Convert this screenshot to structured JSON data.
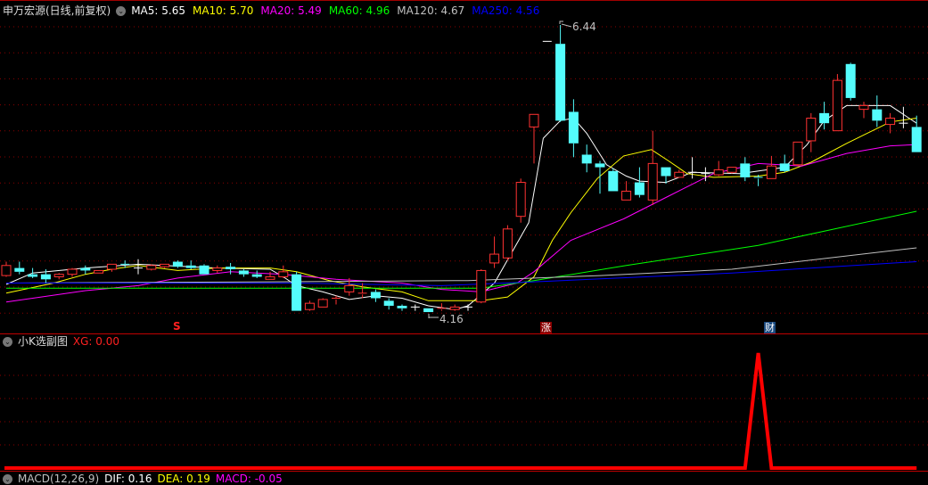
{
  "header": {
    "title": "申万宏源(日线,前复权)",
    "ma": [
      {
        "label": "MA5: 5.65",
        "color": "#ffffff"
      },
      {
        "label": "MA10: 5.70",
        "color": "#ffff00"
      },
      {
        "label": "MA20: 5.49",
        "color": "#ff00ff"
      },
      {
        "label": "MA60: 4.96",
        "color": "#00ff00"
      },
      {
        "label": "MA120: 4.67",
        "color": "#c0c0c0"
      },
      {
        "label": "MA250: 4.56",
        "color": "#0000ff"
      }
    ]
  },
  "sub": {
    "title": "小K选副图",
    "xg_label": "XG: 0.00"
  },
  "macd": {
    "title": "MACD(12,26,9)",
    "dif": "DIF: 0.16",
    "dea": "DEA: 0.19",
    "macd": "MACD: -0.05"
  },
  "markers": {
    "s": "S",
    "zhang": "涨",
    "cai": "财"
  },
  "colors": {
    "up": "#ff3232",
    "down": "#54fcfc",
    "flat": "#ffffff",
    "grid": "#8b0000",
    "xg": "#ff0000"
  },
  "chart_data": [
    {
      "type": "candlestick",
      "price_range": [
        4.16,
        6.44
      ],
      "high_label": "6.44",
      "low_label": "4.16",
      "ohlc": [
        [
          4.45,
          4.56,
          4.44,
          4.53
        ],
        [
          4.51,
          4.56,
          4.46,
          4.48
        ],
        [
          4.46,
          4.51,
          4.43,
          4.44
        ],
        [
          4.46,
          4.5,
          4.39,
          4.42
        ],
        [
          4.44,
          4.47,
          4.42,
          4.46
        ],
        [
          4.46,
          4.51,
          4.44,
          4.5
        ],
        [
          4.51,
          4.53,
          4.46,
          4.49
        ],
        [
          4.47,
          4.49,
          4.47,
          4.49
        ],
        [
          4.5,
          4.54,
          4.48,
          4.54
        ],
        [
          4.54,
          4.57,
          4.51,
          4.53
        ],
        [
          4.51,
          4.58,
          4.46,
          4.51
        ],
        [
          4.5,
          4.54,
          4.49,
          4.53
        ],
        [
          4.52,
          4.54,
          4.51,
          4.54
        ],
        [
          4.56,
          4.57,
          4.51,
          4.52
        ],
        [
          4.53,
          4.57,
          4.5,
          4.51
        ],
        [
          4.53,
          4.54,
          4.46,
          4.46
        ],
        [
          4.49,
          4.53,
          4.47,
          4.51
        ],
        [
          4.52,
          4.55,
          4.46,
          4.5
        ],
        [
          4.49,
          4.5,
          4.44,
          4.46
        ],
        [
          4.46,
          4.49,
          4.43,
          4.44
        ],
        [
          4.42,
          4.48,
          4.42,
          4.44
        ],
        [
          4.44,
          4.53,
          4.43,
          4.48
        ],
        [
          4.46,
          4.48,
          4.17,
          4.17
        ],
        [
          4.18,
          4.25,
          4.17,
          4.23
        ],
        [
          4.2,
          4.27,
          4.2,
          4.26
        ],
        [
          4.26,
          4.29,
          4.22,
          4.27
        ],
        [
          4.32,
          4.43,
          4.29,
          4.37
        ],
        [
          4.3,
          4.39,
          4.27,
          4.31
        ],
        [
          4.32,
          4.34,
          4.24,
          4.27
        ],
        [
          4.25,
          4.27,
          4.18,
          4.21
        ],
        [
          4.21,
          4.22,
          4.17,
          4.19
        ],
        [
          4.2,
          4.22,
          4.17,
          4.2
        ],
        [
          4.19,
          4.19,
          4.16,
          4.16
        ],
        [
          4.18,
          4.23,
          4.17,
          4.19
        ],
        [
          4.18,
          4.22,
          4.17,
          4.2
        ],
        [
          4.2,
          4.22,
          4.17,
          4.2
        ],
        [
          4.24,
          4.5,
          4.23,
          4.49
        ],
        [
          4.55,
          4.76,
          4.51,
          4.62
        ],
        [
          4.59,
          4.85,
          4.57,
          4.82
        ],
        [
          4.92,
          5.22,
          4.87,
          5.19
        ],
        [
          5.63,
          5.73,
          5.34,
          5.73
        ],
        [
          6.31,
          6.31,
          6.31,
          6.31
        ],
        [
          6.29,
          6.44,
          5.67,
          5.68
        ],
        [
          5.75,
          5.85,
          5.39,
          5.5
        ],
        [
          5.41,
          5.49,
          5.27,
          5.34
        ],
        [
          5.34,
          5.36,
          5.1,
          5.31
        ],
        [
          5.28,
          5.3,
          5.12,
          5.12
        ],
        [
          5.05,
          5.2,
          5.05,
          5.12
        ],
        [
          5.19,
          5.31,
          5.07,
          5.09
        ],
        [
          5.05,
          5.6,
          5.01,
          5.34
        ],
        [
          5.31,
          5.31,
          5.18,
          5.24
        ],
        [
          5.23,
          5.29,
          5.23,
          5.27
        ],
        [
          5.27,
          5.39,
          5.22,
          5.27
        ],
        [
          5.26,
          5.31,
          5.2,
          5.26
        ],
        [
          5.25,
          5.36,
          5.24,
          5.29
        ],
        [
          5.27,
          5.31,
          5.26,
          5.31
        ],
        [
          5.34,
          5.39,
          5.2,
          5.23
        ],
        [
          5.23,
          5.25,
          5.16,
          5.22
        ],
        [
          5.22,
          5.4,
          5.22,
          5.32
        ],
        [
          5.34,
          5.41,
          5.27,
          5.28
        ],
        [
          5.33,
          5.51,
          5.32,
          5.51
        ],
        [
          5.52,
          5.74,
          5.43,
          5.7
        ],
        [
          5.74,
          5.83,
          5.61,
          5.66
        ],
        [
          5.6,
          6.05,
          5.6,
          6.0
        ],
        [
          6.13,
          6.14,
          5.84,
          5.86
        ],
        [
          5.77,
          5.83,
          5.7,
          5.8
        ],
        [
          5.77,
          5.88,
          5.63,
          5.68
        ],
        [
          5.65,
          5.74,
          5.58,
          5.7
        ],
        [
          5.66,
          5.79,
          5.62,
          5.66
        ],
        [
          5.63,
          5.72,
          5.43,
          5.43
        ]
      ],
      "ma_lines": [
        {
          "name": "MA5",
          "color": "#ffffff",
          "points": [
            [
              0,
              4.38
            ],
            [
              2,
              4.47
            ],
            [
              6,
              4.51
            ],
            [
              10,
              4.54
            ],
            [
              16,
              4.51
            ],
            [
              20,
              4.5
            ],
            [
              21,
              4.44
            ],
            [
              22,
              4.37
            ],
            [
              24,
              4.32
            ],
            [
              26,
              4.26
            ],
            [
              28,
              4.29
            ],
            [
              30,
              4.27
            ],
            [
              32,
              4.21
            ],
            [
              34,
              4.18
            ],
            [
              35,
              4.21
            ],
            [
              37,
              4.39
            ],
            [
              39.6,
              4.87
            ],
            [
              40.7,
              5.54
            ],
            [
              42,
              5.68
            ],
            [
              43,
              5.7
            ],
            [
              44,
              5.58
            ],
            [
              45.5,
              5.33
            ],
            [
              47,
              5.24
            ],
            [
              48,
              5.2
            ],
            [
              50,
              5.19
            ],
            [
              52,
              5.27
            ],
            [
              55.6,
              5.26
            ],
            [
              59,
              5.31
            ],
            [
              60.7,
              5.49
            ],
            [
              62,
              5.68
            ],
            [
              63.7,
              5.8
            ],
            [
              67,
              5.8
            ],
            [
              69,
              5.66
            ]
          ]
        },
        {
          "name": "MA10",
          "color": "#ffff00",
          "points": [
            [
              0,
              4.31
            ],
            [
              3.6,
              4.39
            ],
            [
              6,
              4.46
            ],
            [
              8,
              4.5
            ],
            [
              10,
              4.53
            ],
            [
              13,
              4.49
            ],
            [
              16,
              4.51
            ],
            [
              20,
              4.51
            ],
            [
              22,
              4.48
            ],
            [
              24.5,
              4.41
            ],
            [
              27,
              4.36
            ],
            [
              30,
              4.32
            ],
            [
              32,
              4.25
            ],
            [
              34,
              4.25
            ],
            [
              36,
              4.25
            ],
            [
              38,
              4.28
            ],
            [
              40,
              4.44
            ],
            [
              41.4,
              4.73
            ],
            [
              42.8,
              4.95
            ],
            [
              44.8,
              5.22
            ],
            [
              46.8,
              5.4
            ],
            [
              48.9,
              5.45
            ],
            [
              50.2,
              5.36
            ],
            [
              51.6,
              5.26
            ],
            [
              53.6,
              5.23
            ],
            [
              57,
              5.24
            ],
            [
              59,
              5.27
            ],
            [
              61,
              5.35
            ],
            [
              63.7,
              5.5
            ],
            [
              67,
              5.67
            ],
            [
              69,
              5.7
            ]
          ]
        },
        {
          "name": "MA20",
          "color": "#ff00ff",
          "points": [
            [
              0,
              4.24
            ],
            [
              6,
              4.33
            ],
            [
              10,
              4.37
            ],
            [
              13,
              4.43
            ],
            [
              17,
              4.48
            ],
            [
              21,
              4.46
            ],
            [
              25,
              4.42
            ],
            [
              30,
              4.39
            ],
            [
              33,
              4.34
            ],
            [
              36,
              4.32
            ],
            [
              38.7,
              4.39
            ],
            [
              40,
              4.48
            ],
            [
              42.8,
              4.73
            ],
            [
              46.8,
              4.9
            ],
            [
              50,
              5.07
            ],
            [
              53.6,
              5.26
            ],
            [
              57,
              5.34
            ],
            [
              60.3,
              5.32
            ],
            [
              63.7,
              5.42
            ],
            [
              67,
              5.48
            ],
            [
              69,
              5.49
            ]
          ]
        },
        {
          "name": "MA60",
          "color": "#00ff00",
          "points": [
            [
              0,
              4.35
            ],
            [
              36,
              4.35
            ],
            [
              40,
              4.41
            ],
            [
              47,
              4.53
            ],
            [
              57,
              4.69
            ],
            [
              69,
              4.96
            ]
          ]
        },
        {
          "name": "MA120",
          "color": "#c0c0c0",
          "points": [
            [
              0,
              4.39
            ],
            [
              20,
              4.4
            ],
            [
              35,
              4.41
            ],
            [
              45,
              4.45
            ],
            [
              55,
              4.5
            ],
            [
              69,
              4.67
            ]
          ]
        },
        {
          "name": "MA250",
          "color": "#0000ff",
          "points": [
            [
              0,
              4.39
            ],
            [
              22,
              4.39
            ],
            [
              33,
              4.37
            ],
            [
              40,
              4.4
            ],
            [
              55,
              4.47
            ],
            [
              69,
              4.56
            ]
          ]
        }
      ]
    },
    {
      "type": "line",
      "name": "XG",
      "ylim": [
        0,
        1
      ],
      "spike_index": 57,
      "count": 70
    }
  ]
}
